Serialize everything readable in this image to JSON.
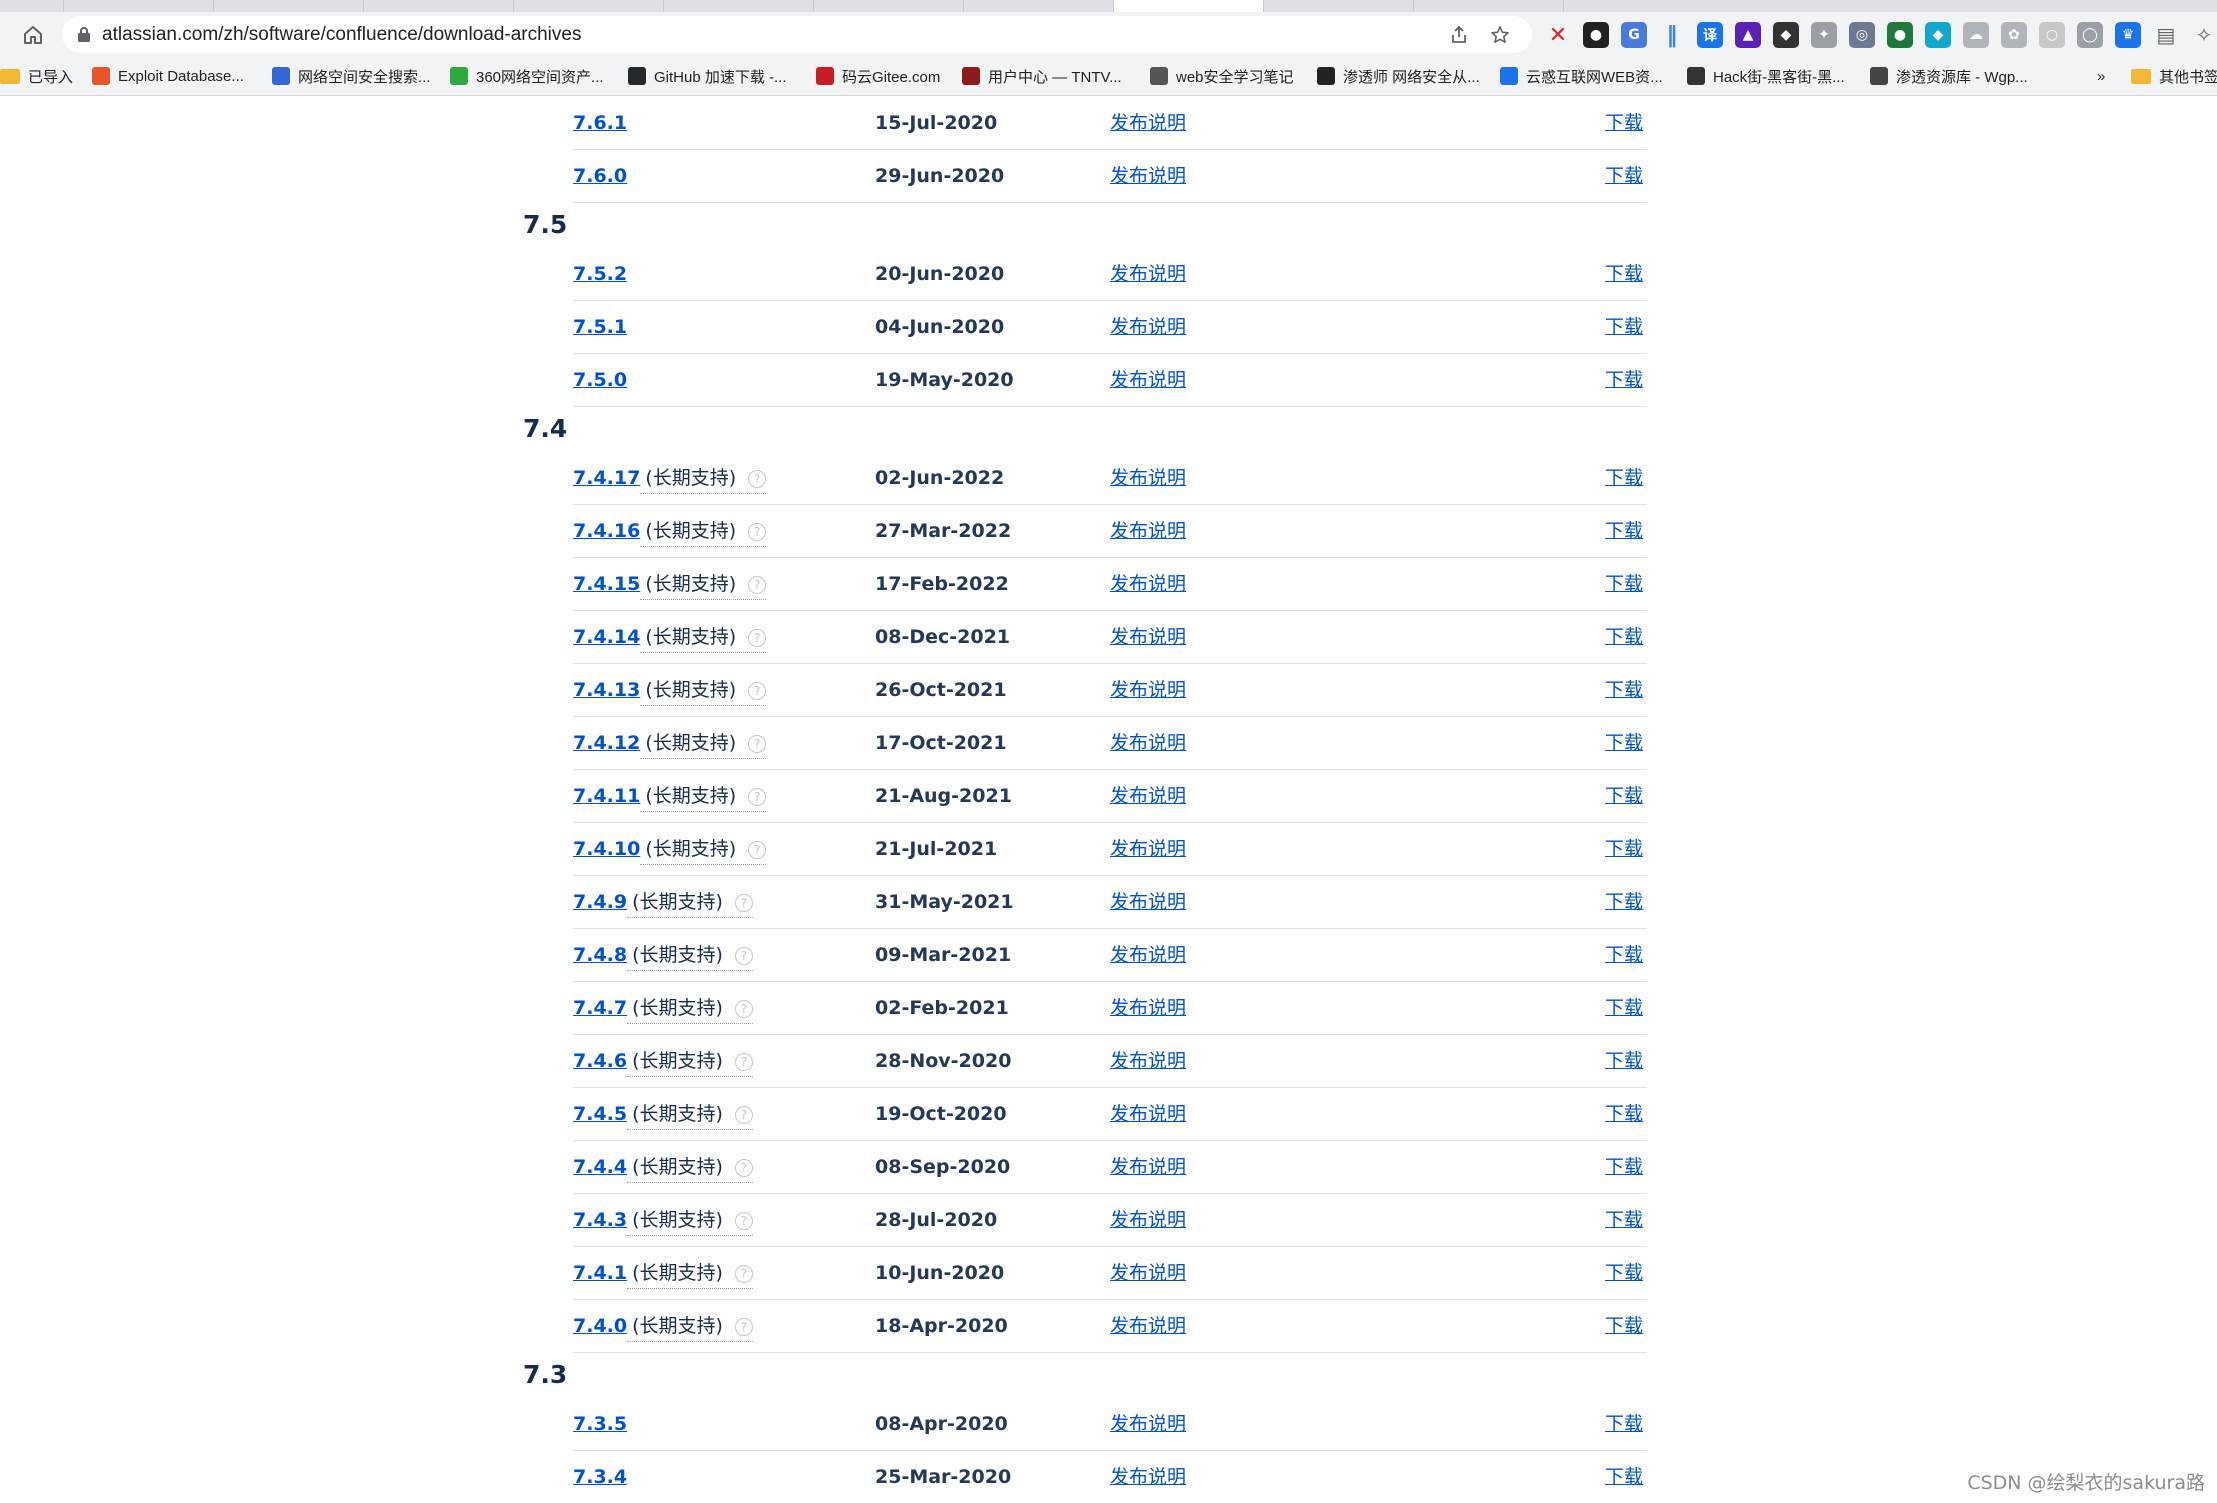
{
  "browser": {
    "url": "atlassian.com/zh/software/confluence/download-archives",
    "bookmarks": [
      {
        "label": "已导入",
        "color": "#f2b833",
        "folder": true
      },
      {
        "label": "Exploit Database...",
        "color": "#e8562a"
      },
      {
        "label": "网络空间安全搜索...",
        "color": "#3367d6"
      },
      {
        "label": "360网络空间资产...",
        "color": "#2eaa3c"
      },
      {
        "label": "GitHub 加速下载 -...",
        "color": "#24292e"
      },
      {
        "label": "码云Gitee.com",
        "color": "#c71d23"
      },
      {
        "label": "用户中心 — TNTV...",
        "color": "#8b1c1c"
      },
      {
        "label": "web安全学习笔记",
        "color": "#555555"
      },
      {
        "label": "渗透师 网络安全从...",
        "color": "#222222"
      },
      {
        "label": "云惑互联网WEB资...",
        "color": "#1a73e8"
      },
      {
        "label": "Hack街-黑客街-黑...",
        "color": "#333333"
      },
      {
        "label": "渗透资源库 - Wgp...",
        "color": "#444444"
      }
    ],
    "bookmarks_more": "»",
    "other_bookmarks": "其他书签"
  },
  "columns": {
    "release_notes": "发布说明",
    "download": "下载",
    "lts_label": "(长期支持)"
  },
  "groups": [
    {
      "title": "",
      "rows": [
        {
          "version": "7.6.1",
          "date": "15-Jul-2020"
        },
        {
          "version": "7.6.0",
          "date": "29-Jun-2020"
        }
      ]
    },
    {
      "title": "7.5",
      "rows": [
        {
          "version": "7.5.2",
          "date": "20-Jun-2020"
        },
        {
          "version": "7.5.1",
          "date": "04-Jun-2020"
        },
        {
          "version": "7.5.0",
          "date": "19-May-2020"
        }
      ]
    },
    {
      "title": "7.4",
      "rows": [
        {
          "version": "7.4.17",
          "date": "02-Jun-2022",
          "lts": true
        },
        {
          "version": "7.4.16",
          "date": "27-Mar-2022",
          "lts": true
        },
        {
          "version": "7.4.15",
          "date": "17-Feb-2022",
          "lts": true
        },
        {
          "version": "7.4.14",
          "date": "08-Dec-2021",
          "lts": true
        },
        {
          "version": "7.4.13",
          "date": "26-Oct-2021",
          "lts": true
        },
        {
          "version": "7.4.12",
          "date": "17-Oct-2021",
          "lts": true
        },
        {
          "version": "7.4.11",
          "date": "21-Aug-2021",
          "lts": true
        },
        {
          "version": "7.4.10",
          "date": "21-Jul-2021",
          "lts": true
        },
        {
          "version": "7.4.9",
          "date": "31-May-2021",
          "lts": true
        },
        {
          "version": "7.4.8",
          "date": "09-Mar-2021",
          "lts": true
        },
        {
          "version": "7.4.7",
          "date": "02-Feb-2021",
          "lts": true
        },
        {
          "version": "7.4.6",
          "date": "28-Nov-2020",
          "lts": true
        },
        {
          "version": "7.4.5",
          "date": "19-Oct-2020",
          "lts": true
        },
        {
          "version": "7.4.4",
          "date": "08-Sep-2020",
          "lts": true
        },
        {
          "version": "7.4.3",
          "date": "28-Jul-2020",
          "lts": true
        },
        {
          "version": "7.4.1",
          "date": "10-Jun-2020",
          "lts": true
        },
        {
          "version": "7.4.0",
          "date": "18-Apr-2020",
          "lts": true
        }
      ]
    },
    {
      "title": "7.3",
      "rows": [
        {
          "version": "7.3.5",
          "date": "08-Apr-2020"
        },
        {
          "version": "7.3.4",
          "date": "25-Mar-2020"
        }
      ]
    }
  ],
  "watermark": "CSDN @绘梨衣的sakura路",
  "colors": {
    "link": "#0052cc",
    "text": "#172b4d",
    "divider": "#dfe1e6"
  }
}
